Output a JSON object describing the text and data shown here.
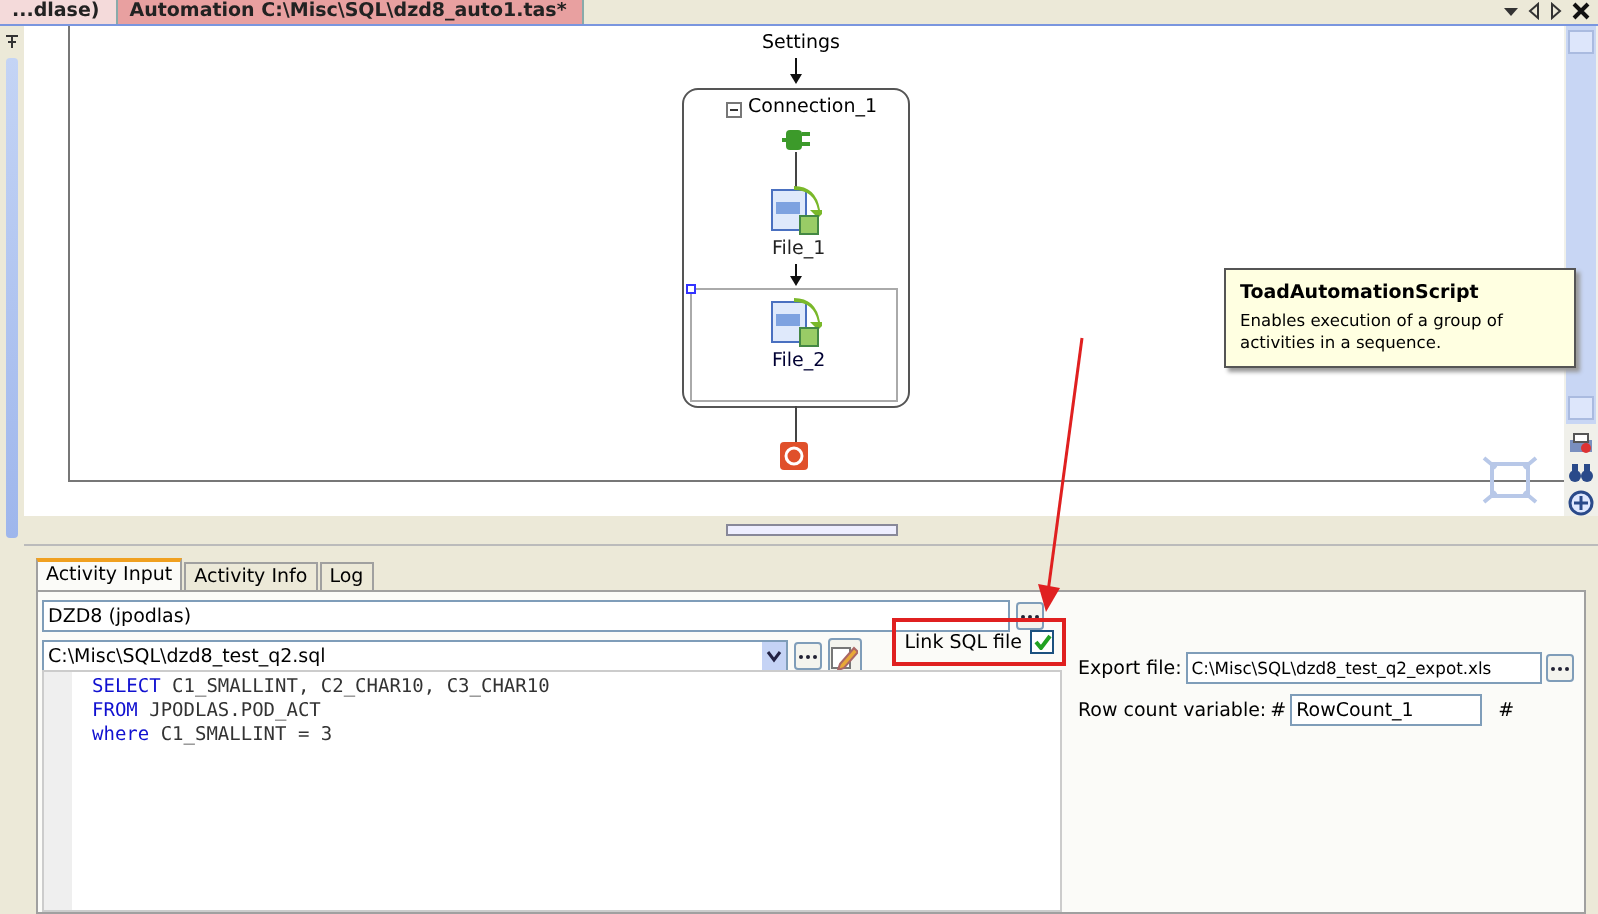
{
  "document_tabs": [
    {
      "label": "...dlase)",
      "selected": false
    },
    {
      "label": "Automation C:\\Misc\\SQL\\dzd8_auto1.tas*",
      "selected": true
    }
  ],
  "diagram": {
    "settings": "Settings",
    "container": {
      "label": "Connection_1",
      "expanded": true
    },
    "nodes": [
      {
        "label": "File_1",
        "selected": false
      },
      {
        "label": "File_2",
        "selected": true
      }
    ]
  },
  "tooltip": {
    "title": "ToadAutomationScript",
    "text": "Enables execution of a group of activities in a sequence."
  },
  "panel_tabs": [
    {
      "label": "Activity Input",
      "selected": true
    },
    {
      "label": "Activity Info",
      "selected": false
    },
    {
      "label": "Log",
      "selected": false
    }
  ],
  "connection": {
    "value": "DZD8 (jpodlas)"
  },
  "sql_file": {
    "value": "C:\\Misc\\SQL\\dzd8_test_q2.sql"
  },
  "link_sql_file": {
    "label": "Link SQL file",
    "checked": true,
    "highlighted": true
  },
  "code_lines": [
    {
      "keyword": "SELECT",
      "text": " C1_SMALLINT, C2_CHAR10, C3_CHAR10"
    },
    {
      "keyword": "FROM",
      "text": " JPODLAS.POD_ACT"
    },
    {
      "keyword": "where",
      "text": " C1_SMALLINT = 3"
    }
  ],
  "export_file": {
    "label": "Export file:",
    "value": "C:\\Misc\\SQL\\dzd8_test_q2_expot.xls"
  },
  "row_count": {
    "label": "Row count variable:",
    "prefix": "#",
    "value": "RowCount_1",
    "suffix": "#"
  }
}
